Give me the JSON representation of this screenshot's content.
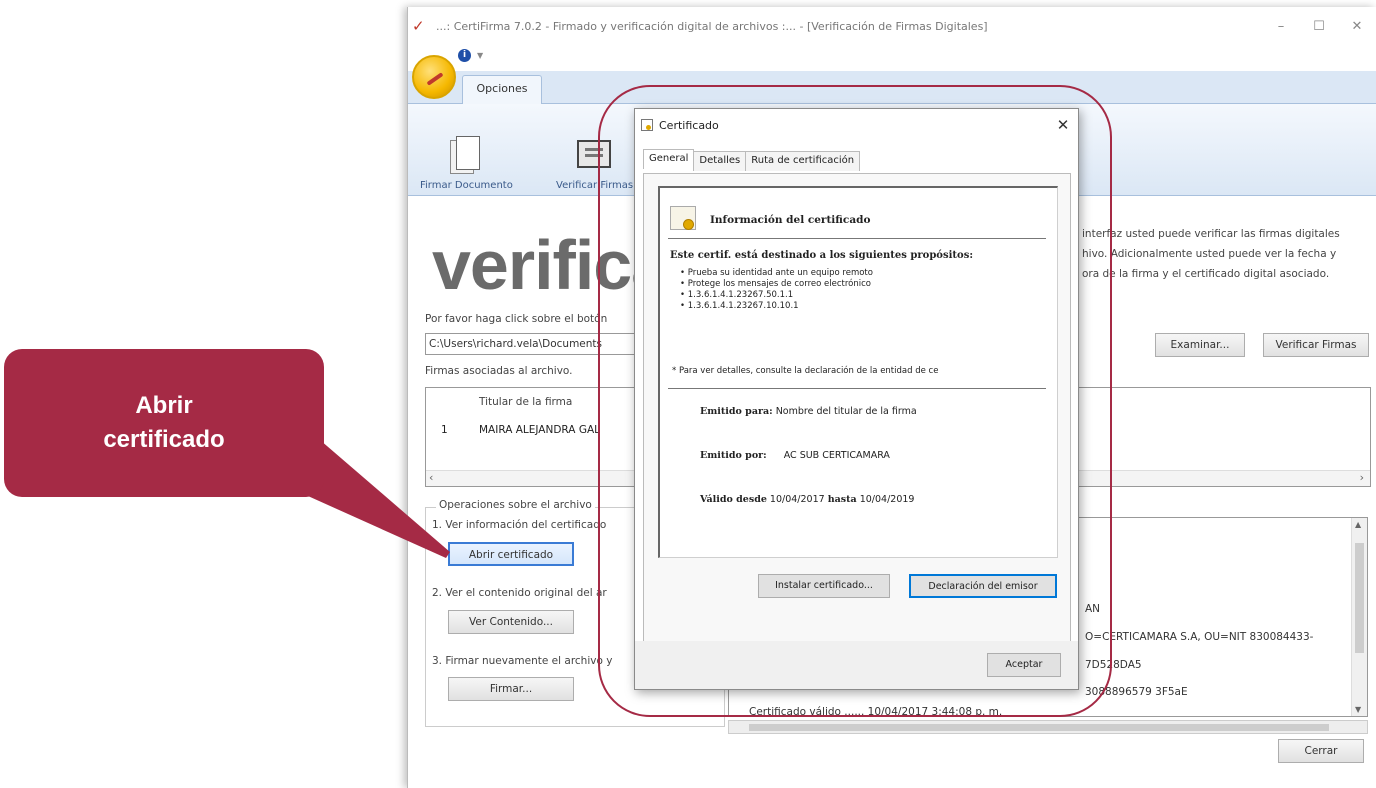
{
  "callout": {
    "line1": "Abrir",
    "line2": "certificado"
  },
  "window": {
    "title": "...: CertiFirma 7.0.2 - Firmado y verificación digital de archivos :... - [Verificación de Firmas Digitales]",
    "minimize": "–",
    "maximize": "☐",
    "close": "✕"
  },
  "ribbon": {
    "tab": "Opciones",
    "buttons": [
      "Firmar Documento",
      "Verificar Firmas"
    ]
  },
  "main": {
    "big_word": "verifica",
    "description": "interfaz usted puede verificar las firmas digitales\nhivo. Adicionalmente usted puede ver la fecha y\nora de la firma y el certificado digital asociado.",
    "instruction": "Por favor haga click sobre el botón",
    "file_path": "C:\\Users\\richard.vela\\Documents",
    "examinar_label": "Examinar...",
    "verificar_label": "Verificar Firmas",
    "firmas_label": "Firmas asociadas al archivo.",
    "grid_header": "Titular de la firma",
    "grid_rows": [
      {
        "num": "1",
        "titular": "MAIRA ALEJANDRA GAL"
      }
    ],
    "ops_legend": "Operaciones sobre el archivo",
    "op1_text": "1. Ver información del certificado",
    "op1_button": "Abrir certificado",
    "op2_text": "2. Ver el contenido original del ar",
    "op2_button": "Ver Contenido...",
    "op3_text": "3. Firmar nuevamente el archivo y",
    "op3_button": "Firmar...",
    "info_lines": [
      "AN",
      "O=CERTICAMARA S.A, OU=NIT 830084433-",
      "7D528DA5",
      "3088896579 3F5aE"
    ],
    "info_bottom": "Certificado válido ...... 10/04/2017 3:44:08 p. m.",
    "cerrar_label": "Cerrar"
  },
  "dialog": {
    "title": "Certificado",
    "close": "✕",
    "tabs": [
      "General",
      "Detalles",
      "Ruta de certificación"
    ],
    "info_title": "Información del certificado",
    "purposes_title": "Este certif. está destinado a los siguientes propósitos:",
    "purposes": [
      "Prueba su identidad ante un equipo remoto",
      "Protege los mensajes de correo electrónico",
      "1.3.6.1.4.1.23267.50.1.1",
      "1.3.6.1.4.1.23267.10.10.1"
    ],
    "note": "* Para ver detalles, consulte la declaración de la entidad de ce",
    "issued_to_label": "Emitido para:",
    "issued_to": "Nombre del titular de la firma",
    "issued_by_label": "Emitido por:",
    "issued_by": "AC SUB CERTICAMARA",
    "valid_from_label": "Válido desde",
    "valid_from": "10/04/2017",
    "valid_to_label": "hasta",
    "valid_to": "10/04/2019",
    "install_button": "Instalar certificado...",
    "declaration_button": "Declaración del emisor",
    "accept_button": "Aceptar"
  }
}
